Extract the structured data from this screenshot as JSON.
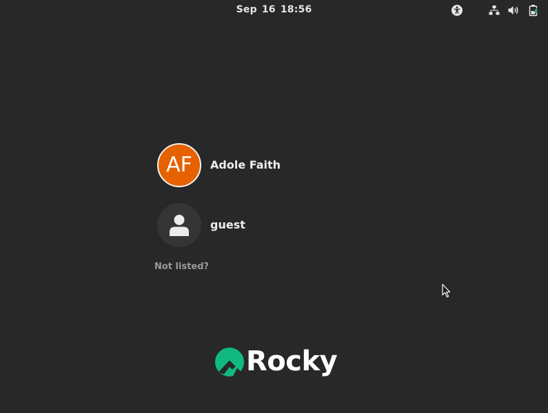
{
  "topbar": {
    "datetime": "Sep 16  18:56",
    "icons": [
      "accessibility-icon",
      "network-icon",
      "volume-icon",
      "battery-icon"
    ]
  },
  "users": [
    {
      "initials": "AF",
      "name": "Adole Faith",
      "avatar_color": "#e66100"
    },
    {
      "initials": "",
      "name": "guest",
      "avatar_color": "#353535"
    }
  ],
  "not_listed_label": "Not listed?",
  "logo": {
    "text": "Rocky",
    "mark_color": "#10b981"
  },
  "colors": {
    "background": "#282828",
    "text": "#eeeeee",
    "muted_text": "#9a9a9a"
  }
}
